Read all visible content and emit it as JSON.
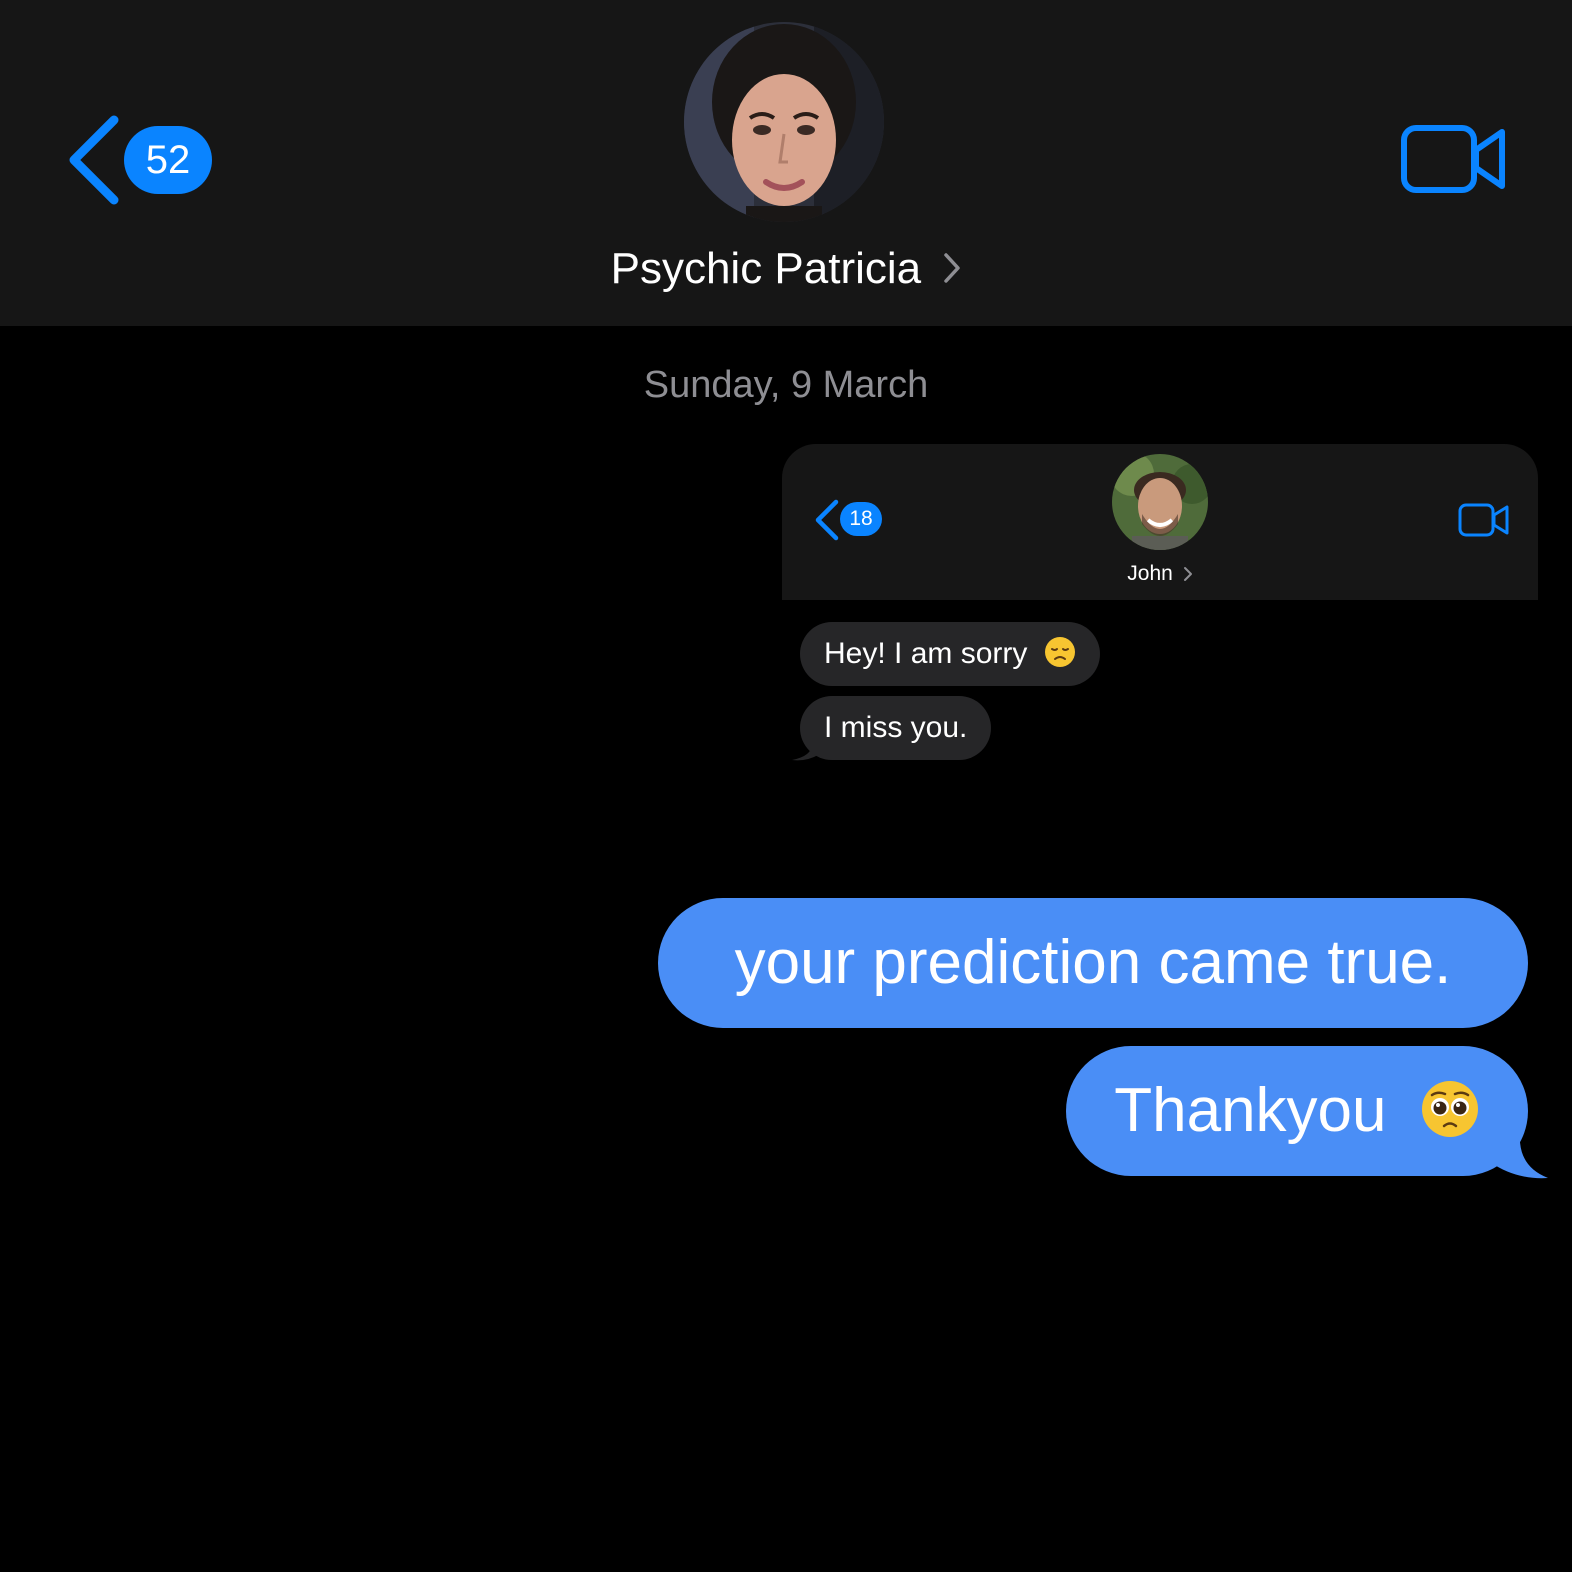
{
  "header": {
    "back_badge": "52",
    "contact_name": "Psychic Patricia"
  },
  "thread": {
    "date_label": "Sunday, 9 March"
  },
  "attachment": {
    "header": {
      "back_badge": "18",
      "contact_name": "John"
    },
    "messages": [
      {
        "text": "Hey! I am sorry",
        "emoji": "disappointed-face"
      },
      {
        "text": "I miss you."
      }
    ]
  },
  "messages": [
    {
      "text": "your prediction came true."
    },
    {
      "text": "Thankyou",
      "emoji": "pleading-face"
    }
  ],
  "colors": {
    "accent": "#0a84ff",
    "outgoing_bubble": "#4a8ef6",
    "incoming_bubble": "#262628",
    "header_bg": "#161616",
    "background": "#000000",
    "secondary_text": "#8e8e93"
  }
}
